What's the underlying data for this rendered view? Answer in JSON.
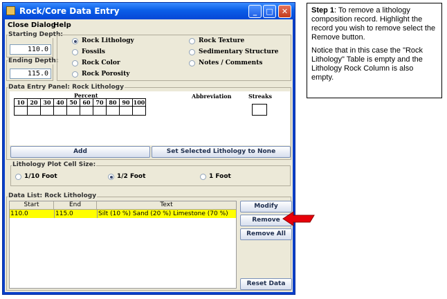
{
  "window": {
    "title": "Rock/Core Data Entry",
    "minimize": "_",
    "maximize": "□",
    "close": "✕"
  },
  "menu": [
    "Close Dialog",
    "Help"
  ],
  "depth": {
    "starting_label": "Starting Depth:",
    "starting_value": "110.0",
    "ending_label": "Ending Depth:",
    "ending_value": "115.0"
  },
  "options": [
    {
      "label": "Rock Lithology",
      "selected": true
    },
    {
      "label": "Fossils",
      "selected": false
    },
    {
      "label": "Rock Color",
      "selected": false
    },
    {
      "label": "Rock Porosity",
      "selected": false
    },
    {
      "label": "Rock Texture",
      "selected": false
    },
    {
      "label": "Sedimentary Structure",
      "selected": false
    },
    {
      "label": "Notes / Comments",
      "selected": false
    }
  ],
  "entry_panel": {
    "title": "Data Entry Panel: Rock Lithology",
    "percent_label": "Percent",
    "percents": [
      "10",
      "20",
      "30",
      "40",
      "50",
      "60",
      "70",
      "80",
      "90",
      "100"
    ],
    "abbreviation_label": "Abbreviation",
    "streaks_label": "Streaks",
    "add_button": "Add",
    "set_none_button": "Set Selected Lithology to None"
  },
  "cell_size": {
    "title": "Lithology Plot Cell Size:",
    "options": [
      {
        "label": "1/10 Foot",
        "selected": false
      },
      {
        "label": "1/2 Foot",
        "selected": true
      },
      {
        "label": "1 Foot",
        "selected": false
      }
    ]
  },
  "data_list": {
    "title": "Data List: Rock Lithology",
    "columns": [
      "Start",
      "End",
      "Text"
    ],
    "rows": [
      {
        "start": "110.0",
        "end": "115.0",
        "text": "Silt (10 %) Sand (20 %) Limestone (70 %)"
      }
    ],
    "modify_button": "Modify",
    "remove_button": "Remove",
    "remove_all_button": "Remove All",
    "reset_button": "Reset Data"
  },
  "note": {
    "step_label": "Step 1",
    "step_text": ":  To remove a lithology composition record.  Highlight the record you wish to remove select the Remove button.",
    "notice": "Notice that in this case the \"Rock Lithology\" Table is empty and the Lithology Rock Column is also empty."
  },
  "colors": {
    "selected_row": "#ffff00",
    "arrow": "#e8000a",
    "titlebar": "#0b5ee8"
  }
}
